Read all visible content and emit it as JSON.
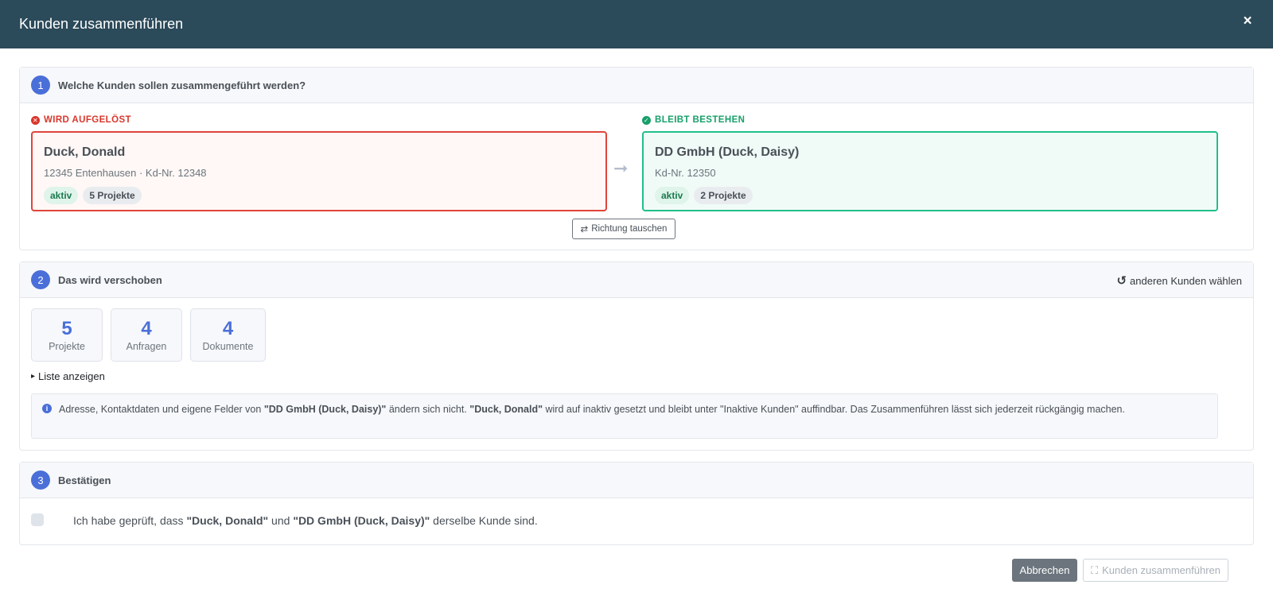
{
  "modal": {
    "title": "Kunden zusammenführen",
    "close": "×"
  },
  "step1": {
    "num": "1",
    "title": "Welche Kunden sollen zusammengeführt werden?",
    "dissolve_label": "WIRD AUFGELÖST",
    "keep_label": "BLEIBT BESTEHEN",
    "source": {
      "name": "Duck, Donald",
      "meta": "12345 Entenhausen · Kd-Nr. 12348",
      "badges": [
        "aktiv",
        "5 Projekte"
      ]
    },
    "target": {
      "name": "DD GmbH (Duck, Daisy)",
      "meta": "Kd-Nr. 12350",
      "badges": [
        "aktiv",
        "2 Projekte"
      ]
    },
    "arrow": "➞",
    "swap_icon": "⇄",
    "swap_label": "Richtung tauschen"
  },
  "step2": {
    "num": "2",
    "title": "Das wird verschoben",
    "reselect_icon": "↺",
    "reselect_label": "anderen Kunden wählen",
    "stats": [
      {
        "value": "5",
        "label": "Projekte"
      },
      {
        "value": "4",
        "label": "Anfragen"
      },
      {
        "value": "4",
        "label": "Dokumente"
      }
    ],
    "toggle_icon": "▸",
    "toggle_label": "Liste anzeigen",
    "info": {
      "icon": "i",
      "p1": "Adresse, Kontaktdaten und eigene Felder von ",
      "target": "\"DD GmbH (Duck, Daisy)\"",
      "p2": " ändern sich nicht. ",
      "source": "\"Duck, Donald\"",
      "p3": " wird auf inaktiv gesetzt und bleibt unter \"Inaktive Kunden\" auffindbar. Das Zusammenführen lässt sich jederzeit rückgängig machen."
    }
  },
  "step3": {
    "num": "3",
    "title": "Bestätigen",
    "p1": "Ich habe geprüft, dass ",
    "source": "\"Duck, Donald\"",
    "p2": " und ",
    "target": "\"DD GmbH (Duck, Daisy)\"",
    "p3": " derselbe Kunde sind."
  },
  "footer": {
    "cancel": "Abbrechen",
    "merge_icon": "⛶",
    "merge": "Kunden zusammenführen"
  }
}
